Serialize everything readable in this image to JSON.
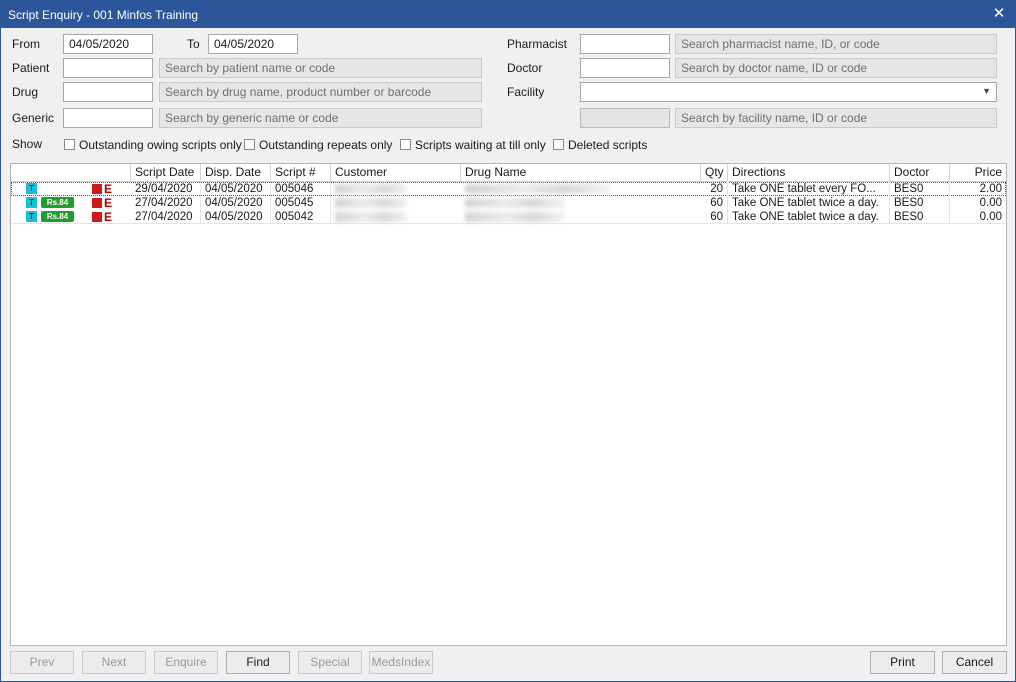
{
  "window": {
    "title": "Script Enquiry - 001 Minfos Training",
    "close_glyph": "✕"
  },
  "filters": {
    "from_label": "From",
    "from_value": "04/05/2020",
    "to_label": "To",
    "to_value": "04/05/2020",
    "patient_label": "Patient",
    "patient_placeholder": "Search by patient name or code",
    "drug_label": "Drug",
    "drug_placeholder": "Search by drug name, product number or barcode",
    "generic_label": "Generic",
    "generic_placeholder": "Search by generic name or code",
    "pharmacist_label": "Pharmacist",
    "pharmacist_placeholder": "Search pharmacist name, ID, or code",
    "doctor_label": "Doctor",
    "doctor_placeholder": "Search by doctor name, ID or code",
    "facility_label": "Facility",
    "facility_value": "",
    "facility_search_placeholder": "Search by facility name, ID or code",
    "show_label": "Show",
    "checkboxes": [
      {
        "label": "Outstanding owing scripts only",
        "checked": false
      },
      {
        "label": "Outstanding repeats only",
        "checked": false
      },
      {
        "label": "Scripts waiting at till only",
        "checked": false
      },
      {
        "label": "Deleted scripts",
        "checked": false
      }
    ]
  },
  "table": {
    "columns": [
      "Script Date",
      "Disp. Date",
      "Script #",
      "Customer",
      "Drug Name",
      "Qty",
      "Directions",
      "Doctor",
      "Price"
    ],
    "rows": [
      {
        "rs": false,
        "script_date": "29/04/2020",
        "disp_date": "04/05/2020",
        "script_no": "005046",
        "qty": "20",
        "directions": "Take ONE tablet every FO...",
        "doctor": "BES0",
        "price": "2.00"
      },
      {
        "rs": true,
        "script_date": "27/04/2020",
        "disp_date": "04/05/2020",
        "script_no": "005045",
        "qty": "60",
        "directions": "Take ONE tablet twice a day.",
        "doctor": "BES0",
        "price": "0.00"
      },
      {
        "rs": true,
        "script_date": "27/04/2020",
        "disp_date": "04/05/2020",
        "script_no": "005042",
        "qty": "60",
        "directions": "Take ONE tablet twice a day.",
        "doctor": "BES0",
        "price": "0.00"
      }
    ],
    "icons": {
      "t_label": "T",
      "rs_label": "Rs.84",
      "e_label": "E"
    }
  },
  "buttons": {
    "prev": "Prev",
    "next": "Next",
    "enquire": "Enquire",
    "find": "Find",
    "special": "Special",
    "medsindex": "MedsIndex",
    "print": "Print",
    "cancel": "Cancel"
  }
}
